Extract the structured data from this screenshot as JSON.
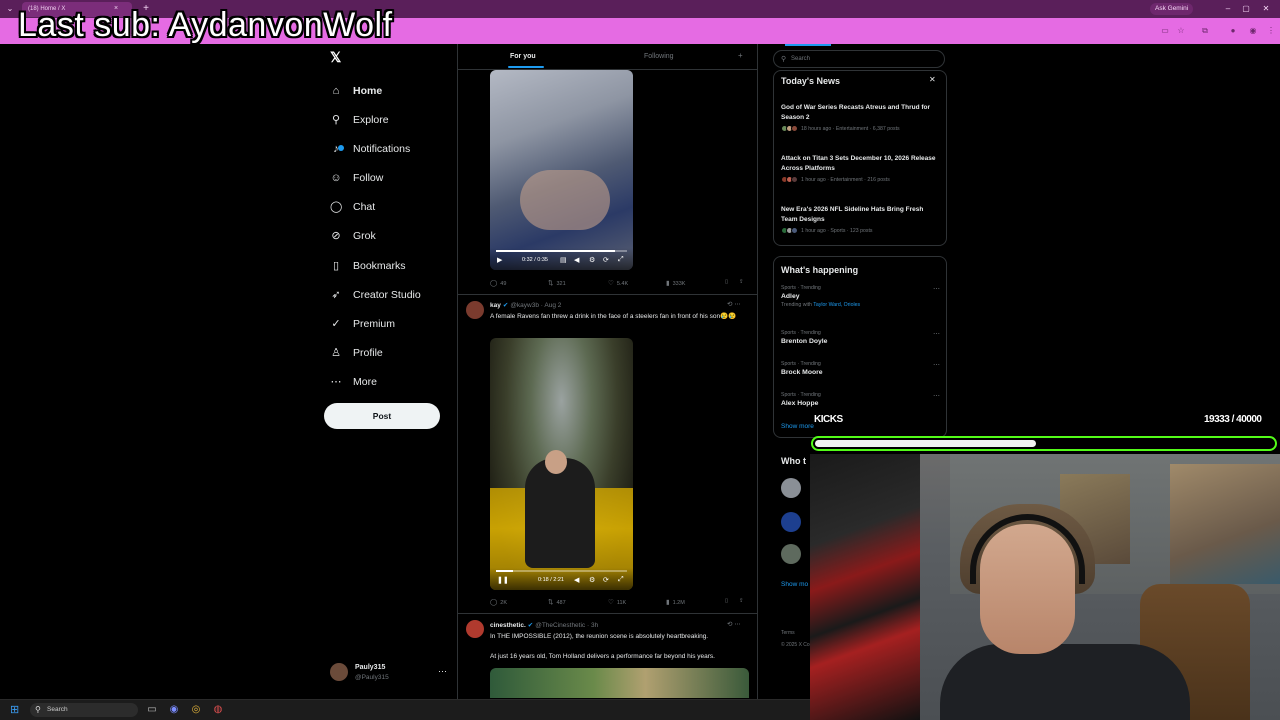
{
  "browser": {
    "tab_title": "(18) Home / X",
    "tab_close": "×",
    "new_tab": "+",
    "ask_gemini": "Ask Gemini"
  },
  "overlay": {
    "last_sub": "Last sub: AydanvonWolf",
    "kicks_label": "KICKS",
    "kicks_count": "19333 / 40000",
    "kicks_progress": 0.483
  },
  "nav": {
    "items": [
      {
        "label": "Home",
        "icon": "home-icon",
        "glyph": "⌂"
      },
      {
        "label": "Explore",
        "icon": "search-icon",
        "glyph": "⚲"
      },
      {
        "label": "Notifications",
        "icon": "bell-icon",
        "glyph": "♪"
      },
      {
        "label": "Follow",
        "icon": "person-add-icon",
        "glyph": "☺"
      },
      {
        "label": "Chat",
        "icon": "chat-icon",
        "glyph": "◯"
      },
      {
        "label": "Grok",
        "icon": "grok-icon",
        "glyph": "⊘"
      },
      {
        "label": "Bookmarks",
        "icon": "bookmark-icon",
        "glyph": "▯"
      },
      {
        "label": "Creator Studio",
        "icon": "rocket-icon",
        "glyph": "➶"
      },
      {
        "label": "Premium",
        "icon": "premium-icon",
        "glyph": "✓"
      },
      {
        "label": "Profile",
        "icon": "profile-icon",
        "glyph": "♙"
      },
      {
        "label": "More",
        "icon": "more-circle-icon",
        "glyph": "⋯"
      }
    ],
    "post_label": "Post"
  },
  "account": {
    "name": "Pauly315",
    "handle": "@Pauly315",
    "more": "⋯"
  },
  "timeline": {
    "tab_for_you": "For you",
    "tab_following": "Following",
    "tab_plus": "+",
    "tweet1": {
      "video_time": "0:32 / 0:35",
      "video_progress": 0.91,
      "replies": "49",
      "reposts": "321",
      "likes": "5.4K",
      "views": "333K"
    },
    "tweet2": {
      "name": "kay",
      "handle": "@kayw3b · Aug 2",
      "text": "A female Ravens fan threw a drink in the face of a steelers fan in front of his son😢😢",
      "video_time": "0:18 / 2:21",
      "video_progress": 0.13,
      "replies": "2K",
      "reposts": "487",
      "likes": "11K",
      "views": "1.2M"
    },
    "tweet3": {
      "name": "cinesthetic.",
      "handle": "@TheCinesthetic · 3h",
      "text": "In THE IMPOSSIBLE (2012), the reunion scene is absolutely heartbreaking.",
      "text2": "At just 16 years old, Tom Holland delivers a performance far beyond his years."
    }
  },
  "sidebar": {
    "search_placeholder": "Search",
    "news_title": "Today's News",
    "news_close": "✕",
    "news": [
      {
        "headline": "God of War Series Recasts Atreus and Thrud for Season 2",
        "meta": "18 hours ago · Entertainment · 6,387 posts"
      },
      {
        "headline": "Attack on Titan 3 Sets December 10, 2026 Release Across Platforms",
        "meta": "1 hour ago · Entertainment · 216 posts"
      },
      {
        "headline": "New Era's 2026 NFL Sideline Hats Bring Fresh Team Designs",
        "meta": "1 hour ago · Sports · 123 posts"
      }
    ],
    "happening_title": "What's happening",
    "trends": [
      {
        "category": "Sports · Trending",
        "name": "Adley",
        "with_prefix": "Trending with ",
        "with_links": "Taylor Ward, Orioles"
      },
      {
        "category": "Sports · Trending",
        "name": "Brenton Doyle"
      },
      {
        "category": "Sports · Trending",
        "name": "Brock Moore"
      },
      {
        "category": "Sports · Trending",
        "name": "Alex Hoppe"
      }
    ],
    "show_more": "Show more",
    "who_title": "Who t",
    "who_show_more": "Show mo",
    "terms": "Terms",
    "terms2": "© 2025 X Corp."
  },
  "taskbar": {
    "search": "Search"
  }
}
